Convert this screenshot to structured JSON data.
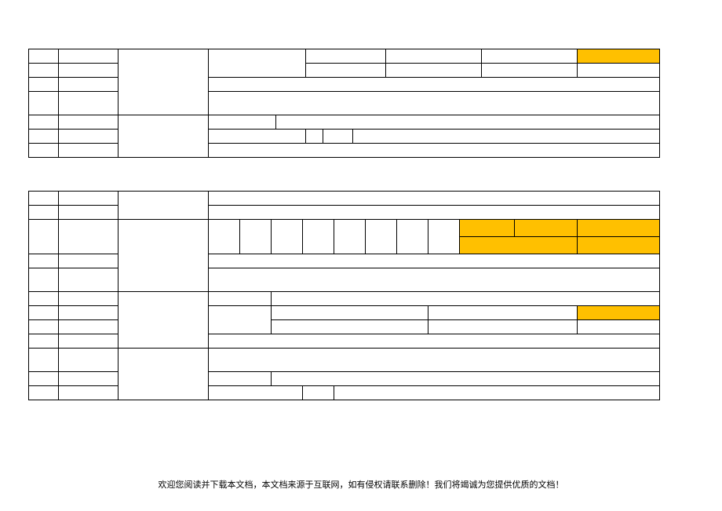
{
  "footer_text": "欢迎您阅读并下载本文档，本文档来源于互联网，如有侵权请联系删除！我们将竭诚为您提供优质的文档！",
  "highlight_color": "#ffc000"
}
